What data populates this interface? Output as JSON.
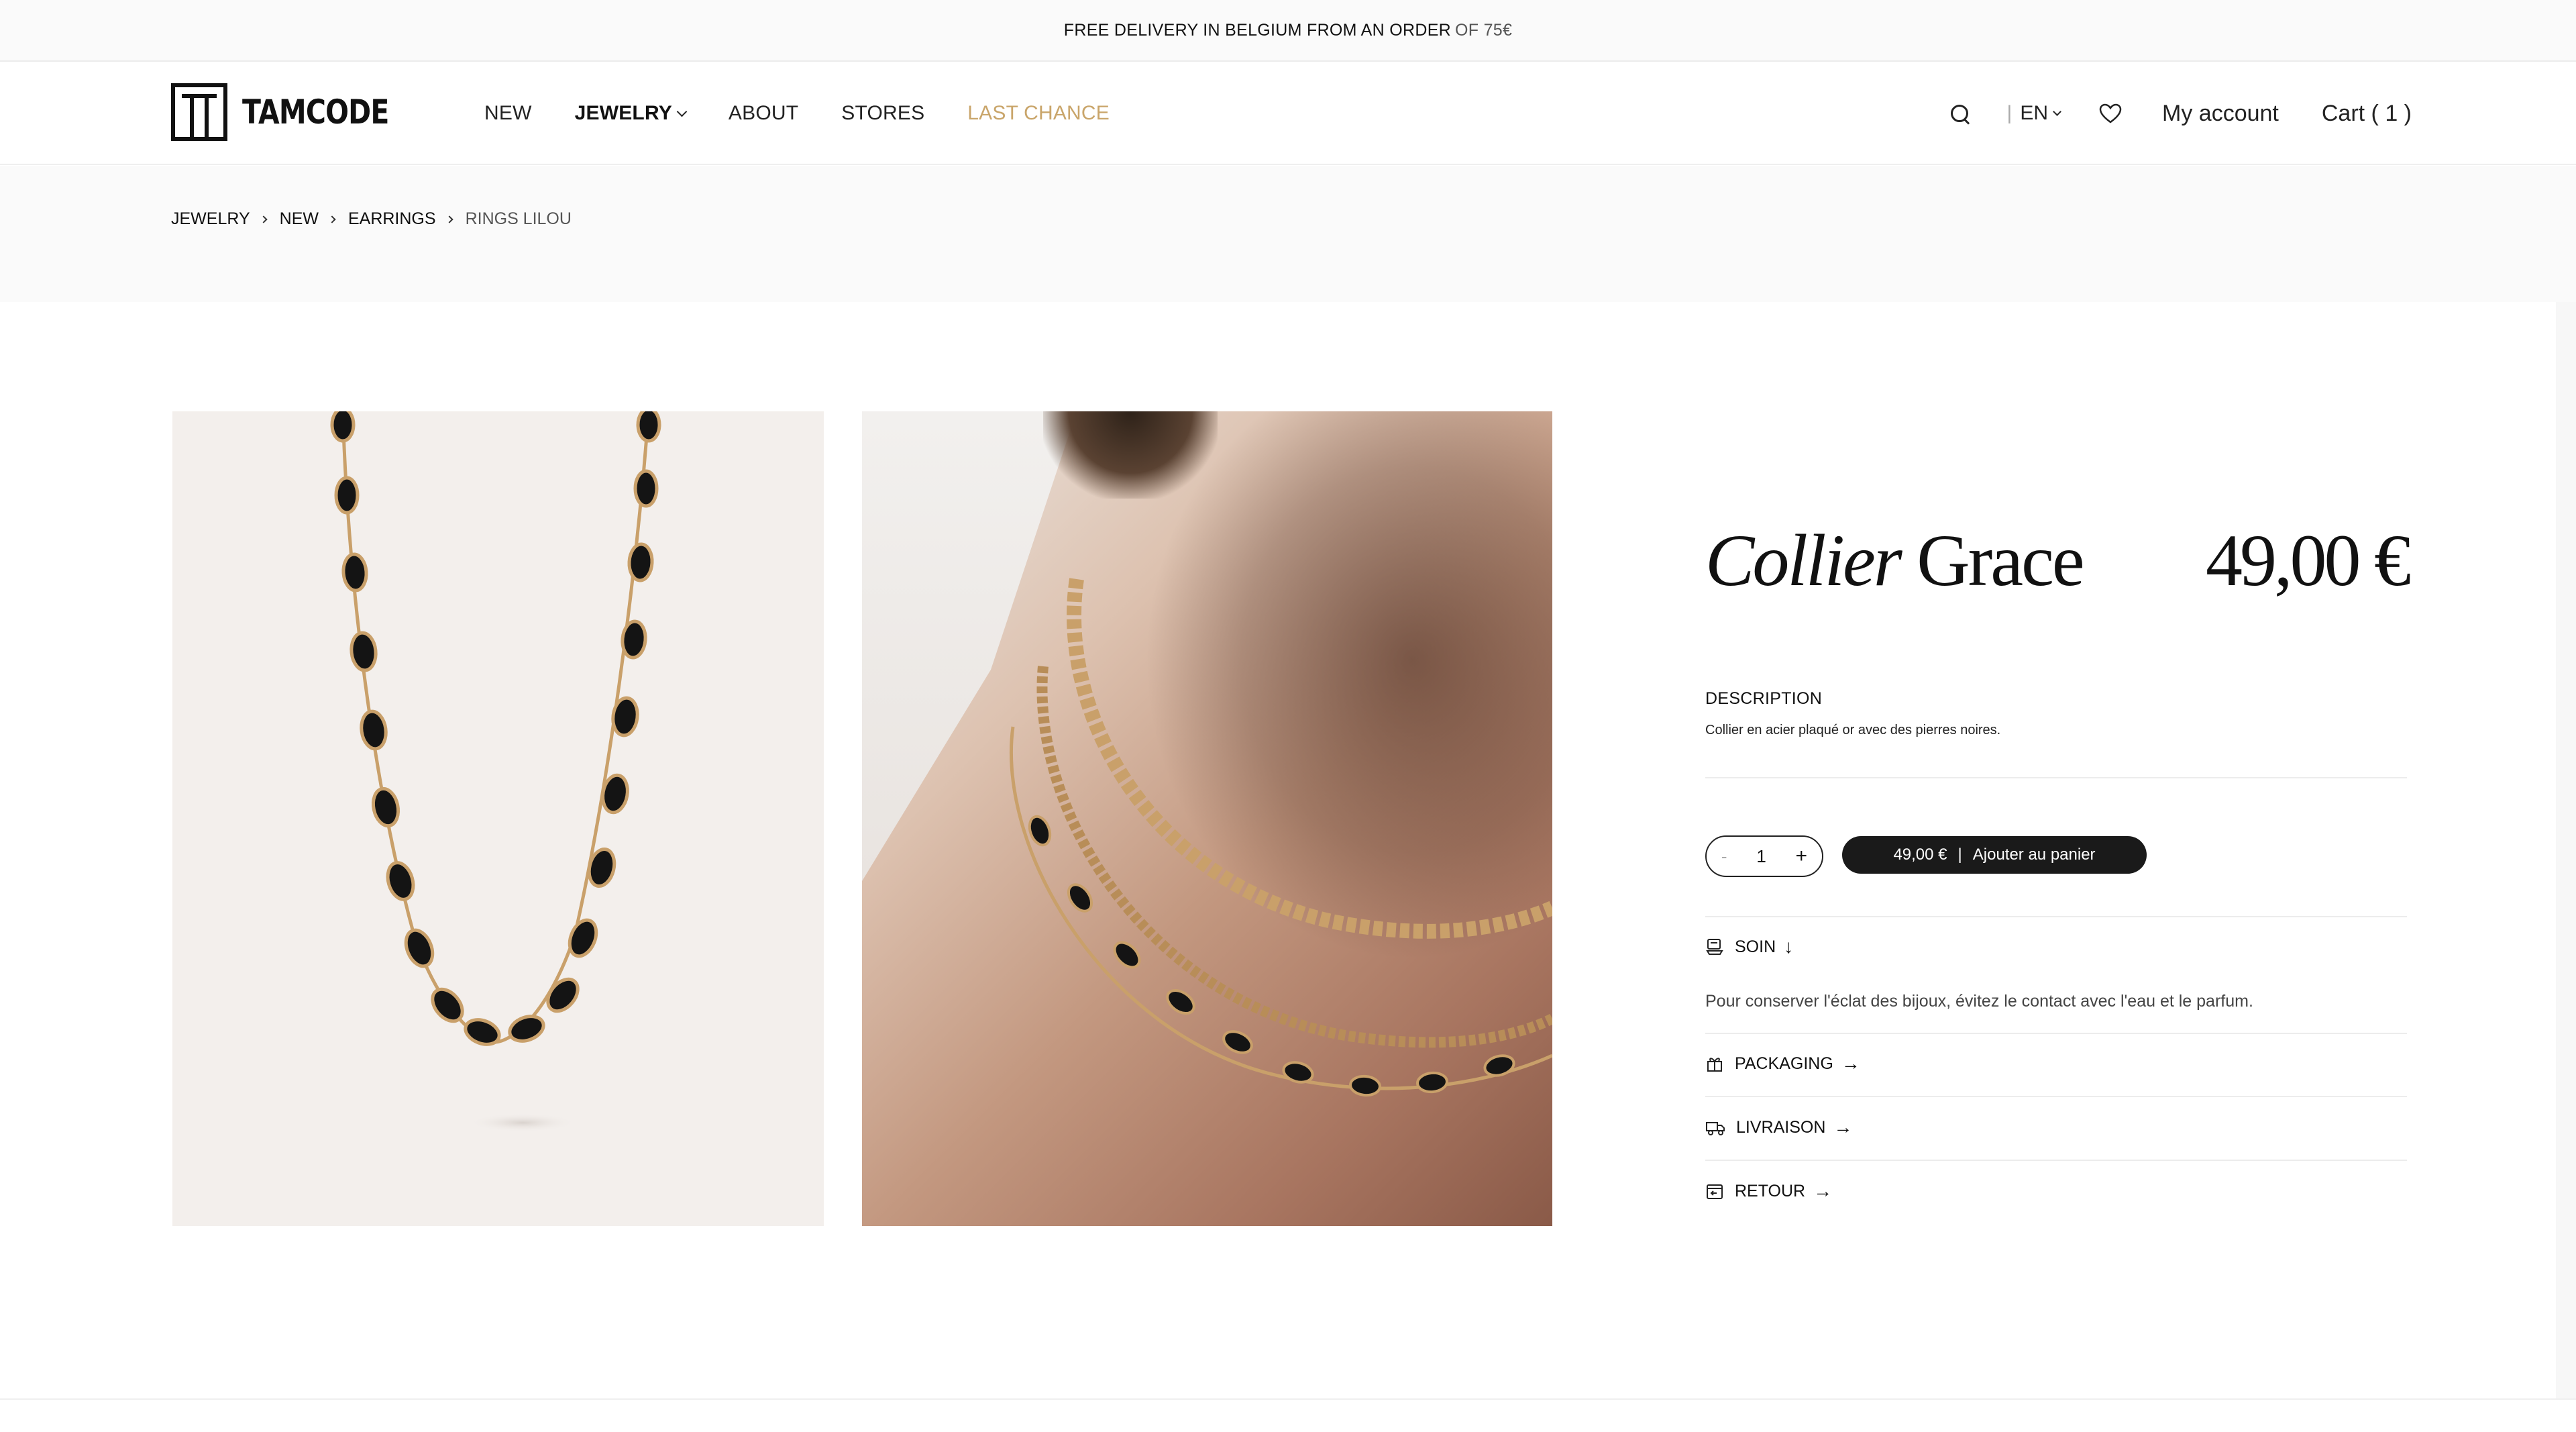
{
  "announcement": {
    "main": "FREE DELIVERY IN BELGIUM FROM AN ORDER",
    "suffix": "OF 75€"
  },
  "brand": {
    "name": "TAMCODE"
  },
  "nav": {
    "items": [
      {
        "label": "NEW"
      },
      {
        "label": "JEWELRY"
      },
      {
        "label": "ABOUT"
      },
      {
        "label": "STORES"
      },
      {
        "label": "LAST CHANCE"
      }
    ]
  },
  "header_actions": {
    "language": "EN",
    "account": "My account",
    "cart": "Cart ( 1 )"
  },
  "breadcrumb": [
    "JEWELRY",
    "NEW",
    "EARRINGS",
    "RINGS LILOU"
  ],
  "product": {
    "title_italic": "Collier",
    "title_rest": "Grace",
    "price": "49,00 €",
    "description_label": "DESCRIPTION",
    "description": "Collier en acier plaqué or avec des pierres noires.",
    "quantity": "1",
    "add_price": "49,00 €",
    "add_separator": "|",
    "add_label": "Ajouter au panier"
  },
  "accordion": {
    "soin": {
      "label": "SOIN",
      "text": "Pour conserver l'éclat des bijoux, évitez le contact avec l'eau et le parfum."
    },
    "packaging": {
      "label": "PACKAGING"
    },
    "livraison": {
      "label": "LIVRAISON"
    },
    "retour": {
      "label": "RETOUR"
    }
  },
  "colors": {
    "gold": "#c9a56a",
    "button": "#1a1a1a",
    "band": "#fafafa"
  }
}
